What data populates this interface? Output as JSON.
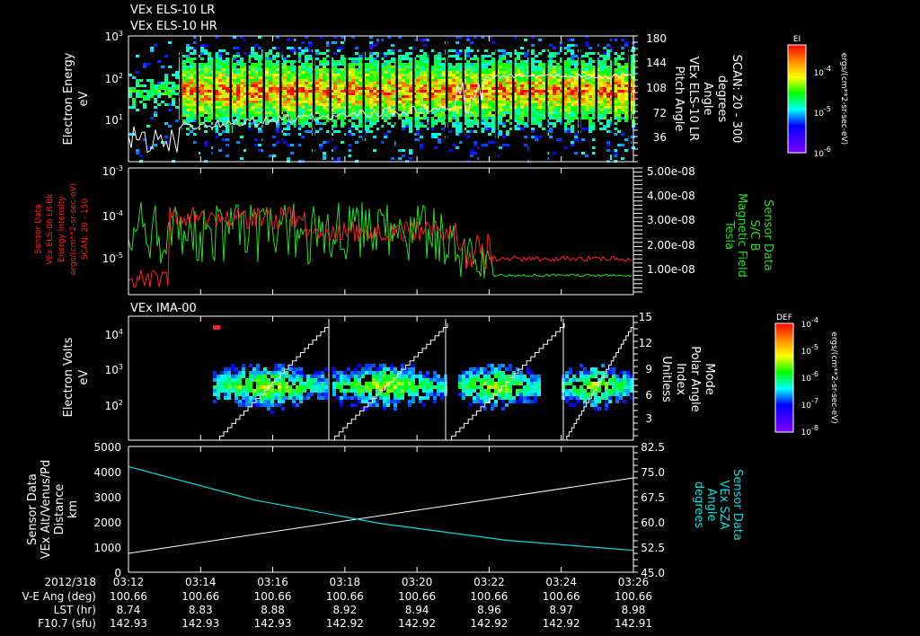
{
  "chart_data": [
    {
      "type": "heatmap",
      "titles": [
        "VEx ELS-10 LR",
        "VEx ELS-10 HR"
      ],
      "ylabel": [
        "Electron Energy",
        "eV"
      ],
      "yticks": [
        "10^3",
        "10^2",
        "10^1"
      ],
      "ylim_log": [
        0.1,
        3
      ],
      "right_label": [
        "Pitch Angle",
        "VEx ELS-10 LR",
        "Angle",
        "degrees",
        "SCAN: 20 - 300"
      ],
      "right_ticks": [
        "180",
        "144",
        "108",
        "72",
        "36"
      ],
      "colorbar": {
        "title": "EI",
        "ticks": [
          "10^-4",
          "10^-5",
          "10^-6"
        ],
        "units": "ergs/(cm**2-sr-sec-eV)"
      },
      "overlay_line": "pitch angle (white)"
    },
    {
      "type": "line",
      "ylabel": [
        "Sensor Data",
        "VEx ELS-06 LR-Bk",
        "Energy Intensity",
        "ergs/(cm**2-sr-sec-eV)",
        "SCAN: 20 - 150"
      ],
      "yticks": [
        "10^-3",
        "10^-4",
        "10^-5"
      ],
      "right_label": [
        "Sensor Data",
        "S/C B",
        "Magnetic Field",
        "Tesla"
      ],
      "right_ticks": [
        "5.00e-08",
        "4.00e-08",
        "3.00e-08",
        "2.00e-08",
        "1.00e-08"
      ],
      "series": [
        {
          "name": "Energy Intensity",
          "color": "#ff2020"
        },
        {
          "name": "Magnetic Field",
          "color": "#20e020"
        }
      ]
    },
    {
      "type": "heatmap",
      "title": "VEx IMA-00",
      "ylabel": [
        "Electron Volts",
        "eV"
      ],
      "yticks": [
        "10^4",
        "10^3",
        "10^2"
      ],
      "right_label": [
        "Mode",
        "Polar Angle",
        "Index",
        "Unitless"
      ],
      "right_ticks": [
        "15",
        "12",
        "9",
        "6",
        "3"
      ],
      "colorbar": {
        "title": "DEF",
        "ticks": [
          "10^-4",
          "10^-5",
          "10^-6",
          "10^-7",
          "10^-8"
        ],
        "units": "ergs/(cm**2-sr-sec-eV)"
      }
    },
    {
      "type": "line",
      "ylabel": [
        "Sensor Data",
        "VEx Alt/Venus/Pd",
        "Distance",
        "km"
      ],
      "yticks": [
        "5000",
        "4000",
        "3000",
        "2000",
        "1000",
        "0"
      ],
      "ylim": [
        0,
        5000
      ],
      "right_label": [
        "Sensor Data",
        "VEx SZA",
        "Angle",
        "degrees"
      ],
      "right_ticks": [
        "82.5",
        "75.0",
        "67.5",
        "60.0",
        "52.5",
        "45.0"
      ],
      "y2lim": [
        45,
        82.5
      ],
      "series": [
        {
          "name": "Altitude",
          "color": "#ffffff",
          "x": [
            0,
            14
          ],
          "y": [
            750,
            3750
          ]
        },
        {
          "name": "SZA",
          "color": "#00e0e0",
          "x": [
            0,
            3.5,
            7,
            10.5,
            14
          ],
          "y2": [
            76.5,
            66.5,
            59.5,
            54.5,
            51.5
          ]
        }
      ]
    }
  ],
  "footer": {
    "row_labels": [
      "2012/318",
      "V-E Ang (deg)",
      "LST (hr)",
      "F10.7 (sfu)"
    ],
    "times": [
      "03:12",
      "03:14",
      "03:16",
      "03:18",
      "03:20",
      "03:22",
      "03:24",
      "03:26"
    ],
    "ve_ang": [
      "100.66",
      "100.66",
      "100.66",
      "100.66",
      "100.66",
      "100.66",
      "100.66",
      "100.66"
    ],
    "lst": [
      "8.74",
      "8.83",
      "8.88",
      "8.92",
      "8.94",
      "8.96",
      "8.97",
      "8.98"
    ],
    "f107": [
      "142.93",
      "142.93",
      "142.93",
      "142.92",
      "142.92",
      "142.92",
      "142.92",
      "142.91"
    ]
  }
}
